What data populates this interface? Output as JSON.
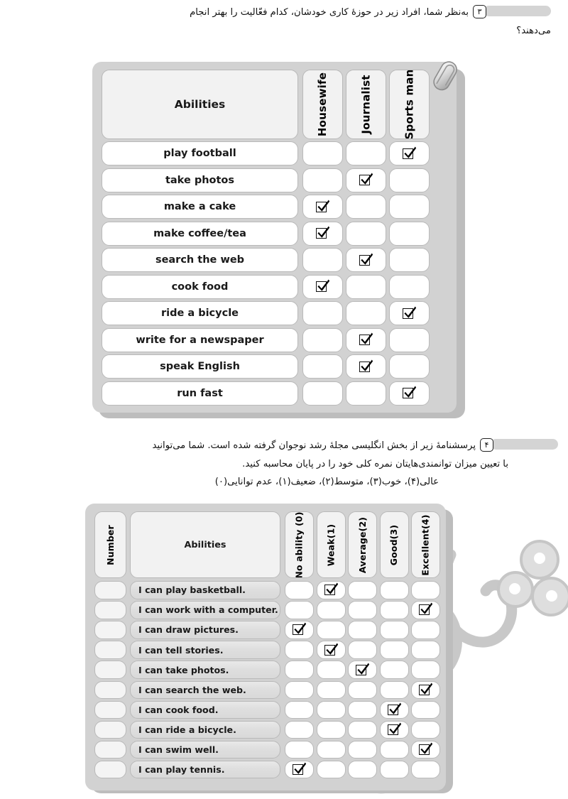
{
  "questions": [
    {
      "number": "۳",
      "lines": [
        "به‌نظر شما، افراد زیر در حوزهٔ کاری خودشان، کدام فعّالیت را بهتر انجام",
        "می‌دهند؟"
      ]
    },
    {
      "number": "۴",
      "lines": [
        "پرسشنامهٔ زیر از بخش انگلیسی مجلهٔ رشد نوجوان گرفته شده است. شما می‌توانید",
        "با تعیین میزان توانمندی‌هایتان نمره کلی خود را در پایان محاسبه کنید.",
        "عالی(۴)، خوب(۳)، متوسط(۲)، ضعیف(۱)، عدم توانایی(۰)"
      ]
    }
  ],
  "table1": {
    "header_label": "Abilities",
    "columns": [
      "Housewife",
      "Journalist",
      "Sports man"
    ],
    "rows": [
      {
        "label": "play football",
        "checked": 2
      },
      {
        "label": "take photos",
        "checked": 1
      },
      {
        "label": "make a cake",
        "checked": 0
      },
      {
        "label": "make coffee/tea",
        "checked": 0
      },
      {
        "label": "search the web",
        "checked": 1
      },
      {
        "label": "cook food",
        "checked": 0
      },
      {
        "label": "ride a bicycle",
        "checked": 2
      },
      {
        "label": "write for a newspaper",
        "checked": 1
      },
      {
        "label": "speak English",
        "checked": 1
      },
      {
        "label": "run fast",
        "checked": 2
      }
    ],
    "decoration": "paperclip-icon"
  },
  "table2": {
    "number_header": "Number",
    "header_label": "Abilities",
    "columns": [
      "No ability (0)",
      "Weak(1)",
      "Average(2)",
      "Good(3)",
      "Excellent(4)"
    ],
    "rows": [
      {
        "number": "",
        "label": "I can play basketball.",
        "checked": 1
      },
      {
        "number": "",
        "label": "I can work with a computer.",
        "checked": 4
      },
      {
        "number": "",
        "label": "I can draw pictures.",
        "checked": 0
      },
      {
        "number": "",
        "label": "I can tell stories.",
        "checked": 1
      },
      {
        "number": "",
        "label": "I can take photos.",
        "checked": 2
      },
      {
        "number": "",
        "label": "I can search the web.",
        "checked": 4
      },
      {
        "number": "",
        "label": "I can cook food.",
        "checked": 3
      },
      {
        "number": "",
        "label": "I can ride a bicycle.",
        "checked": 3
      },
      {
        "number": "",
        "label": "I can swim well.",
        "checked": 4
      },
      {
        "number": "",
        "label": "I can play tennis.",
        "checked": 0
      }
    ],
    "decoration": "calligraphy-watermark"
  },
  "colors": {
    "page_background": "#ffffff",
    "table_frame": "#d2d2d2",
    "table_shadow": "#bdbdbd",
    "cell_border": "#b9b9b9",
    "cell_fill": "#ffffff",
    "header_fill": "#f2f2f2",
    "ability_fill": "#dedede",
    "question_bar": "#d4d4d4",
    "text": "#1a1a1a",
    "watermark": "#c9c9c9"
  }
}
